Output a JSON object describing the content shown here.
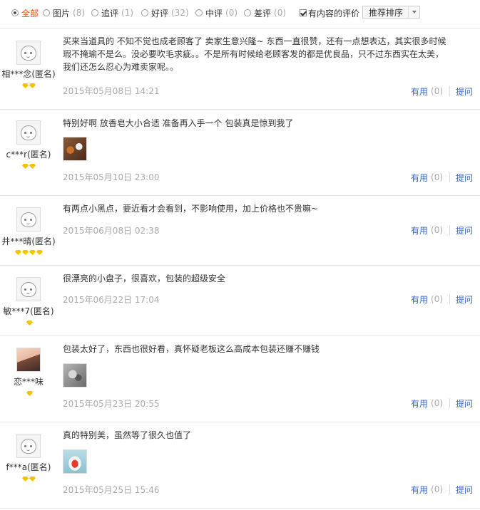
{
  "filters": [
    {
      "label": "全部",
      "count": "",
      "active": true
    },
    {
      "label": "图片",
      "count": "(8)"
    },
    {
      "label": "追评",
      "count": "(1)"
    },
    {
      "label": "好评",
      "count": "(32)"
    },
    {
      "label": "中评",
      "count": "(0)"
    },
    {
      "label": "差评",
      "count": "(0)"
    }
  ],
  "content_only": {
    "label": "有内容的评价",
    "checked": true
  },
  "sort": {
    "selected": "推荐排序"
  },
  "colors": {
    "active_filter": "#ff4400",
    "link": "#3366cc",
    "muted": "#aaaaaa",
    "rank_diamond": "#f5c400"
  },
  "reviews": [
    {
      "user": "相***念(匿名)",
      "rank_diamonds": 2,
      "avatar": "default-face-icon",
      "content_lines": [
        "买来当道具的 不知不觉也成老顾客了 卖家生意兴隆~ 东西一直很赞，还有一点想表达，其实很多时候",
        "瑕不掩瑜不是么。没必要吹毛求疵。。不是所有时候给老顾客发的都是优良品，只不过东西实在太美，",
        "我们还怎么忍心为难卖家呢。。"
      ],
      "date": "2015年05月08日 14:21",
      "useful_label": "有用",
      "useful_count": "(0)",
      "ask_label": "提问"
    },
    {
      "user": "c***r(匿名)",
      "rank_diamonds": 2,
      "avatar": "default-face-icon",
      "content_lines": [
        "特别好啊 放香皂大小合适 准备再入手一个 包装真是惊到我了"
      ],
      "has_photo": true,
      "date": "2015年05月10日 23:00",
      "useful_label": "有用",
      "useful_count": "(0)",
      "ask_label": "提问"
    },
    {
      "user": "井***晴(匿名)",
      "rank_diamonds": 4,
      "avatar": "default-face-icon",
      "content_lines": [
        "有两点小黑点，要近看才会看到，不影响使用，加上价格也不贵嘛~"
      ],
      "date": "2015年06月08日 02:38",
      "useful_label": "有用",
      "useful_count": "(0)",
      "ask_label": "提问"
    },
    {
      "user": "敏***7(匿名)",
      "rank_diamonds": 1,
      "avatar": "default-face-icon",
      "content_lines": [
        "很漂亮的小盘子，很喜欢，包装的超级安全"
      ],
      "date": "2015年06月22日 17:04",
      "useful_label": "有用",
      "useful_count": "(0)",
      "ask_label": "提问"
    },
    {
      "user": "恋***味",
      "rank_diamonds": 1,
      "avatar": "user-photo",
      "content_lines": [
        "包装太好了，东西也很好看，真怀疑老板这么高成本包装还赚不赚钱"
      ],
      "has_photo": true,
      "date": "2015年05月23日 20:55",
      "useful_label": "有用",
      "useful_count": "(0)",
      "ask_label": "提问"
    },
    {
      "user": "f***a(匿名)",
      "rank_diamonds": 2,
      "avatar": "default-face-icon",
      "content_lines": [
        "真的特别美，虽然等了很久也值了"
      ],
      "has_photo": true,
      "date": "2015年05月25日 15:46",
      "useful_label": "有用",
      "useful_count": "(0)",
      "ask_label": "提问"
    }
  ]
}
